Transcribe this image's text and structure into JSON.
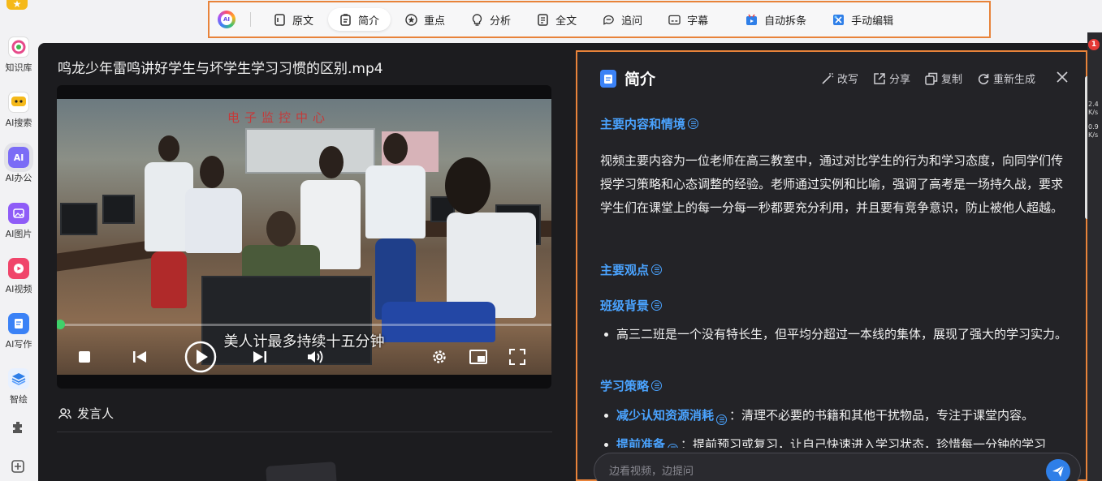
{
  "toolbar": {
    "logo_text": "AI",
    "items": [
      {
        "label": "原文",
        "icon": "document-icon"
      },
      {
        "label": "简介",
        "icon": "summary-icon",
        "active": true
      },
      {
        "label": "重点",
        "icon": "star-circle-icon"
      },
      {
        "label": "分析",
        "icon": "lightbulb-icon"
      },
      {
        "label": "全文",
        "icon": "fulltext-icon"
      },
      {
        "label": "追问",
        "icon": "chat-bubble-icon"
      },
      {
        "label": "字幕",
        "icon": "subtitle-icon"
      },
      {
        "label": "自动拆条",
        "icon": "auto-split-icon"
      },
      {
        "label": "手动编辑",
        "icon": "manual-edit-icon"
      }
    ]
  },
  "sidebar": {
    "items": [
      {
        "label": "知识库",
        "icon": "knowledge-base-icon",
        "color": "#ffffff"
      },
      {
        "label": "AI搜索",
        "icon": "ai-search-icon",
        "color": "#ffffff"
      },
      {
        "label": "AI办公",
        "icon": "ai-office-icon",
        "color": "#7b6cf6",
        "active": true
      },
      {
        "label": "AI图片",
        "icon": "ai-image-icon",
        "color": "#8f5cf7"
      },
      {
        "label": "AI视频",
        "icon": "ai-video-icon",
        "color": "#f0456a"
      },
      {
        "label": "AI写作",
        "icon": "ai-writing-icon",
        "color": "#3b82f6"
      },
      {
        "label": "智绘",
        "icon": "zhihui-icon",
        "color": "#2f7fe8"
      }
    ]
  },
  "video": {
    "title": "鸣龙少年雷鸣讲好学生与坏学生学习习惯的区别.mp4",
    "scene_sign": "电子监控中心",
    "subtitle": "美人计最多持续十五分钟",
    "progress": 0.003
  },
  "speaker": {
    "label": "发言人"
  },
  "panel": {
    "title": "简介",
    "actions": [
      "改写",
      "分享",
      "复制",
      "重新生成"
    ],
    "sections": {
      "main_content_heading": "主要内容和情境",
      "main_content_text": "视频主要内容为一位老师在高三教室中，通过对比学生的行为和学习态度，向同学们传授学习策略和心态调整的经验。老师通过实例和比喻，强调了高考是一场持久战，要求学生们在课堂上的每一分每一秒都要充分利用，并且要有竞争意识，防止被他人超越。",
      "main_points_heading": "主要观点",
      "class_bg_heading": "班级背景",
      "class_bg_bullet": "高三二班是一个没有特长生，但平均分超过一本线的集体，展现了强大的学习实力。",
      "strategy_heading": "学习策略",
      "strategy_bullet1_kw": "减少认知资源消耗",
      "strategy_bullet1_text": "：清理不必要的书籍和其他干扰物品，专注于课堂内容。",
      "strategy_bullet2_kw": "提前准备",
      "strategy_bullet2_text": "：提前预习或复习，让自己快速进入学习状态，珍惜每一分钟的学习"
    },
    "ask_placeholder": "边看视频，边提问"
  },
  "edge": {
    "badge": "1",
    "line1": "2.4",
    "line2": "K/s",
    "line3": "0.9",
    "line4": "K/s"
  },
  "colors": {
    "accent": "#4aa3ff",
    "highlight_border": "#e8833a",
    "app_bg": "#1c1c1f",
    "progress": "#3fd16a"
  }
}
